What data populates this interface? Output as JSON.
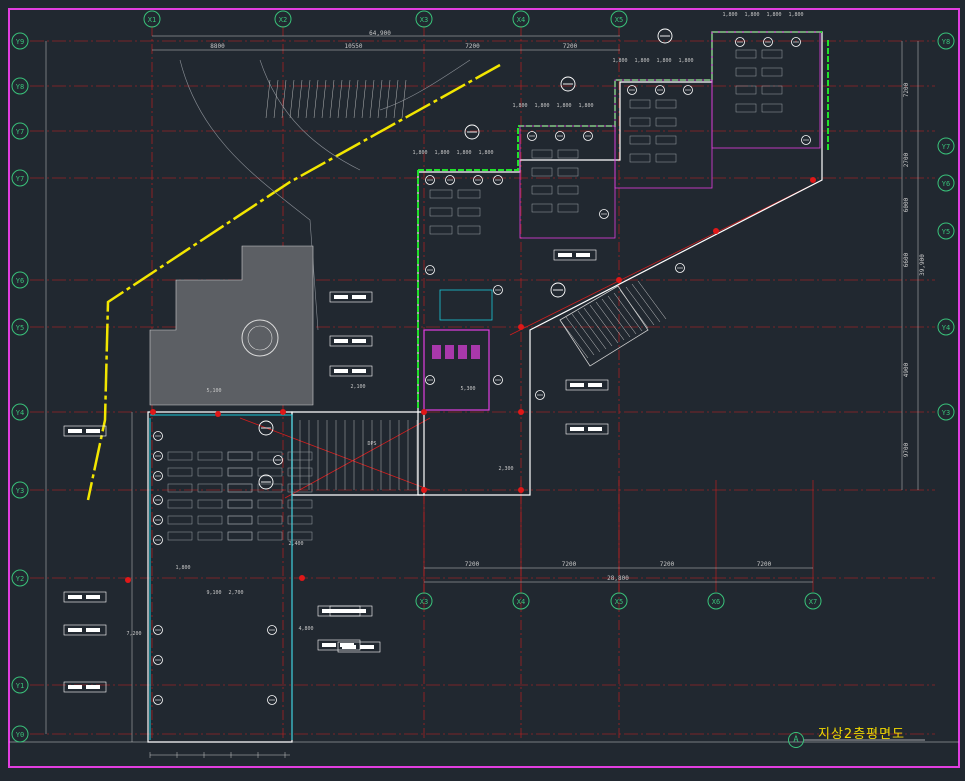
{
  "drawing": {
    "title": "지상2층평면도",
    "sheet_mark": "A",
    "colors": {
      "background": "#212830",
      "frame": "#e23ee0",
      "grid_line": "#d21e1e",
      "dimension": "#c9c9c9",
      "wall": "#ffffff",
      "highlight": "#20e22a",
      "boundary": "#f2e600",
      "accent_cyan": "#19c9d9",
      "accent_magenta": "#e23ee0",
      "title_text": "#f2d900",
      "bubble": "#39c27a"
    }
  },
  "grid": {
    "columns_top": [
      "X1",
      "X2",
      "X3",
      "X4",
      "X5"
    ],
    "columns_bottom": [
      "X3",
      "X4",
      "X5",
      "X6",
      "X7"
    ],
    "rows_left": [
      "Y9",
      "Y8",
      "Y7",
      "Y7",
      "Y6",
      "Y5",
      "Y4",
      "Y3",
      "Y2",
      "Y1",
      "Y0"
    ],
    "rows_right": [
      "Y8",
      "Y7",
      "Y6",
      "Y5",
      "Y4",
      "Y3"
    ]
  },
  "dimensions": {
    "top_total": "64,900",
    "top_spans": [
      "8800",
      "10550",
      "7200",
      "7200"
    ],
    "bottom_total": "28,800",
    "bottom_spans": [
      "7200",
      "7200",
      "7200",
      "7200"
    ],
    "room_modules": [
      "1,800",
      "1,800",
      "1,800",
      "1,800"
    ],
    "right_side": [
      "7200",
      "2700",
      "6000",
      "6600",
      "4900",
      "9700"
    ],
    "right_total": "39,900",
    "misc": [
      "5,100",
      "2,300",
      "1,800",
      "2,700",
      "2,100",
      "2,400",
      "4,800",
      "7,200",
      "9,100",
      "5,300",
      "DPS"
    ]
  }
}
